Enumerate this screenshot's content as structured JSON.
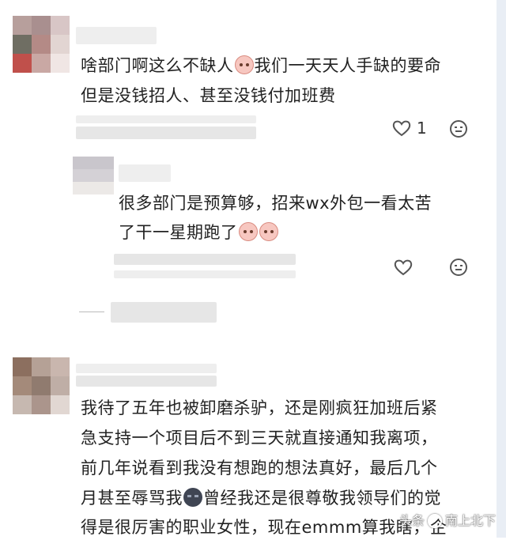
{
  "comments": [
    {
      "text_line1_a": "啥部门啊这么不缺人",
      "text_line1_b": "我们一天天人手缺的要命",
      "text_line2": "但是没钱招人、甚至没钱付加班费",
      "emoji": "crying-face-icon",
      "like_count": "1"
    },
    {
      "text_line1": "很多部门是预算够，招来wx外包一看太苦",
      "text_line2": "了干一星期跑了",
      "emojis": [
        "crying-face-icon",
        "crying-face-icon"
      ]
    },
    {
      "lines": [
        "我待了五年也被卸磨杀驴，还是刚疯狂加班后紧",
        "急支持一个项目后不到三天就直接通知我离项，",
        "前几年说看到我没有想跑的想法真好，最后几个"
      ],
      "line4_a": "月甚至辱骂我",
      "line4_b": "曾经我还是很尊敬我领导们的觉",
      "line5": "得是很厉害的职业女性，现在emmm算我瞎，企",
      "emoji": "dark-face-icon"
    }
  ],
  "watermark": {
    "prefix": "头条",
    "author": "南上北下"
  },
  "colors": {
    "text": "#222222",
    "icon": "#555555",
    "edge": "#e9eef5"
  }
}
